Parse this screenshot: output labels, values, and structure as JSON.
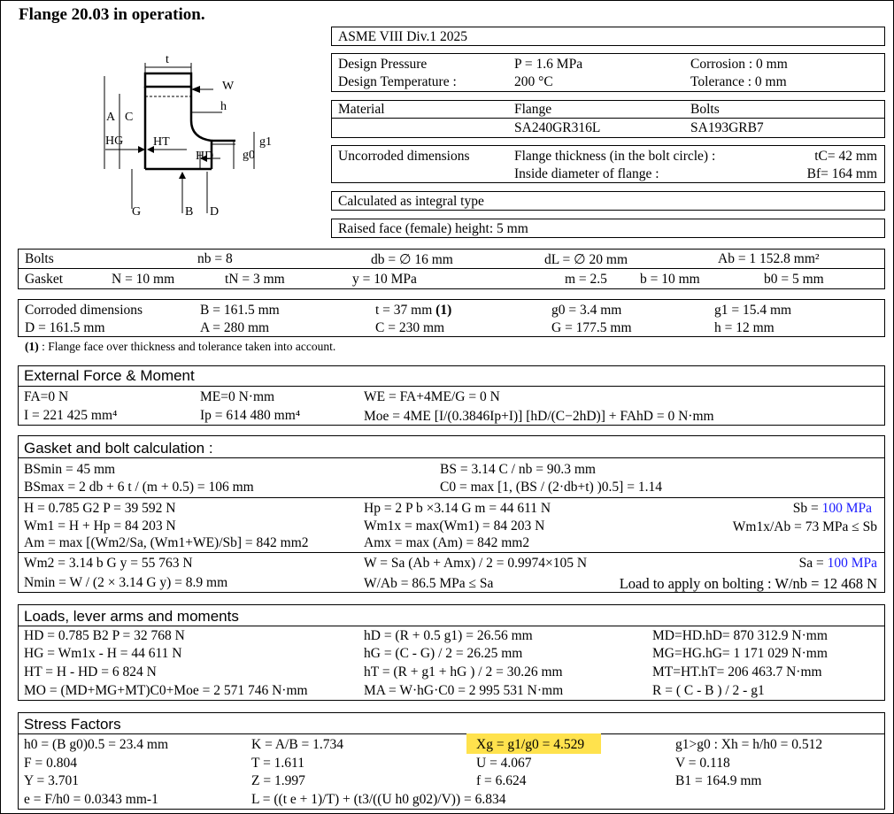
{
  "title": "Flange 20.03 in operation.",
  "code": "ASME VIII Div.1 2025",
  "design": {
    "pressure_label": "Design Pressure",
    "pressure": "P = 1.6 MPa",
    "temp_label": "Design Temperature :",
    "temp": "200 °C",
    "corrosion": "Corrosion : 0 mm",
    "tolerance": "Tolerance : 0 mm"
  },
  "material": {
    "label": "Material",
    "flange_head": "Flange",
    "bolts_head": "Bolts",
    "flange": "SA240GR316L",
    "bolts": "SA193GRB7"
  },
  "uncorroded": {
    "label": "Uncorroded dimensions",
    "tc_label": "Flange thickness (in the bolt circle) :",
    "tc": "tC= 42 mm",
    "bf_label": "Inside diameter of flange :",
    "bf": "Bf= 164 mm"
  },
  "calc_type": "Calculated as integral type",
  "raised_face": "Raised face (female) height: 5 mm",
  "diagram_labels": {
    "t": "t",
    "W": "W",
    "h": "h",
    "A": "A",
    "C": "C",
    "HG": "HG",
    "HT": "HT",
    "HD": "HD",
    "g0": "g0",
    "g1": "g1",
    "G": "G",
    "B": "B",
    "D": "D"
  },
  "bolts": {
    "label": "Bolts",
    "nb": "nb = 8",
    "db": "db = ∅ 16 mm",
    "dl": "dL = ∅ 20 mm",
    "ab": "Ab = 1 152.8 mm²"
  },
  "gasket": {
    "label": "Gasket",
    "N": "N = 10 mm",
    "tN": "tN = 3 mm",
    "y": "y = 10 MPa",
    "m": "m = 2.5",
    "b": "b = 10 mm",
    "b0": "b0 = 5 mm"
  },
  "corroded": {
    "label": "Corroded dimensions",
    "B": "B = 161.5 mm",
    "t": "t = 37 mm",
    "t_note": "(1)",
    "g0": "g0 = 3.4 mm",
    "g1": "g1 = 15.4 mm",
    "D": "D = 161.5 mm",
    "A": "A = 280 mm",
    "C": "C = 230 mm",
    "G": "G = 177.5 mm",
    "h": "h = 12 mm",
    "note_mark": "(1)",
    "note": " : Flange face over thickness and tolerance taken into account."
  },
  "external": {
    "title": "External Force & Moment",
    "FA": "FA=0 N",
    "ME": "ME=0 N·mm",
    "WE": "WE = FA+4ME/G = 0 N",
    "I": "I = 221 425 mm⁴",
    "Ip": "Ip = 614 480 mm⁴",
    "Moe": "Moe = 4ME [I/(0.3846Ip+I)] [hD/(C−2hD)] + FAhD = 0 N·mm"
  },
  "gasket_bolt": {
    "title": "Gasket and bolt calculation :",
    "bsmin": "BSmin = 45 mm",
    "bs": "BS = 3.14 C / nb = 90.3 mm",
    "bsmax": "BSmax = 2 db + 6 t / (m + 0.5) = 106 mm",
    "c0": "C0 = max [1, (BS / (2·db+t) )0.5] = 1.14",
    "H": "H = 0.785 G2 P = 39 592 N",
    "Hp": "Hp = 2 P b ×3.14 G m = 44 611 N",
    "Sb_label": "Sb = ",
    "Sb_value": "100 MPa",
    "Wm1": "Wm1 = H + Hp = 84 203 N",
    "Wm1x": "Wm1x = max(Wm1) = 84 203 N",
    "Wm1x_Ab": "Wm1x/Ab = 73 MPa ≤ Sb",
    "Am": "Am = max [(Wm2/Sa, (Wm1+WE)/Sb] = 842 mm2",
    "Amx": "Amx = max (Am) = 842 mm2",
    "Wm2": "Wm2 = 3.14 b G y = 55 763 N",
    "W": "W = Sa (Ab + Amx) / 2 = 0.9974×105 N",
    "Sa_label": "Sa = ",
    "Sa_value": "100 MPa",
    "Nmin": "Nmin = W / (2 × 3.14 G y) = 8.9 mm",
    "W_Ab": "W/Ab = 86.5 MPa ≤ Sa",
    "load": "Load to apply on bolting : W/nb = 12 468 N"
  },
  "loads": {
    "title": "Loads, lever arms and moments",
    "HD": "HD = 0.785 B2 P = 32 768 N",
    "hD": "hD = (R + 0.5 g1) = 26.56 mm",
    "MD": "MD=HD.hD= 870 312.9 N·mm",
    "HG": "HG = Wm1x - H = 44 611 N",
    "hG": "hG = (C - G) / 2 = 26.25 mm",
    "MG": "MG=HG.hG= 1 171 029 N·mm",
    "HT": "HT = H - HD = 6 824 N",
    "hT": "hT = (R + g1 + hG ) / 2 = 30.26 mm",
    "MT": "MT=HT.hT= 206 463.7 N·mm",
    "MO": "MO = (MD+MG+MT)C0+Moe = 2 571 746 N·mm",
    "MA": "MA = W·hG·C0 = 2 995 531 N·mm",
    "R": "R = ( C - B ) / 2 - g1"
  },
  "stress": {
    "title": "Stress Factors",
    "h0": "h0 = (B g0)0.5 = 23.4 mm",
    "K": "K = A/B = 1.734",
    "Xg": "Xg = g1/g0 = 4.529",
    "Xh": "g1>g0 : Xh = h/h0 = 0.512",
    "F": "F = 0.804",
    "T": "T = 1.611",
    "U": "U = 4.067",
    "V": "V = 0.118",
    "Y": "Y = 3.701",
    "Z": "Z = 1.997",
    "f": "f = 6.624",
    "B1": "B1 = 164.9 mm",
    "e": "e = F/h0 = 0.0343 mm-1",
    "L": "L = ((t e + 1)/T) + (t3/((U h0 g02)/V)) = 6.834"
  },
  "colors": {
    "highlight": "#ffe24d",
    "blue": "#1a1aff"
  }
}
